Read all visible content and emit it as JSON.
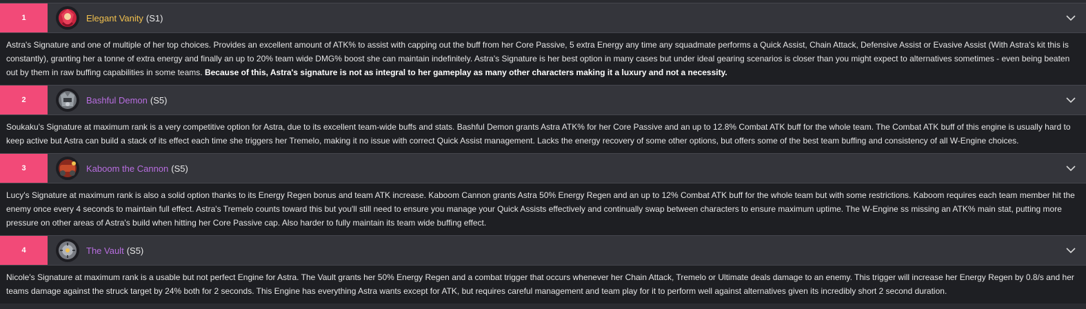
{
  "items": [
    {
      "rank": "1",
      "name": "Elegant Vanity",
      "rank_label": "(S1)",
      "name_color": "gold",
      "icon": "elegant-vanity-engine-icon",
      "description": "Astra's Signature and one of multiple of her top choices. Provides an excellent amount of ATK% to assist with capping out the buff from her Core Passive, 5 extra Energy any time any squadmate performs a Quick Assist, Chain Attack, Defensive Assist or Evasive Assist (With Astra's kit this is constantly), granting her a tonne of extra energy and finally an up to 20% team wide DMG% boost she can maintain indefinitely. Astra's Signature is her best option in many cases but under ideal gearing scenarios is closer than you might expect to alternatives sometimes - even being beaten out by them in raw buffing capabilities in some teams. ",
      "description_bold": "Because of this, Astra's signature is not as integral to her gameplay as many other characters making it a luxury and not a necessity."
    },
    {
      "rank": "2",
      "name": "Bashful Demon",
      "rank_label": "(S5)",
      "name_color": "purple",
      "icon": "bashful-demon-engine-icon",
      "description": "Soukaku's Signature at maximum rank is a very competitive option for Astra, due to its excellent team-wide buffs and stats. Bashful Demon grants Astra ATK% for her Core Passive and an up to 12.8% Combat ATK buff for the whole team. The Combat ATK buff of this engine is usually hard to keep active but Astra can build a stack of its effect each time she triggers her Tremelo, making it no issue with correct Quick Assist management. Lacks the energy recovery of some other options, but offers some of the best team buffing and consistency of all W-Engine choices.",
      "description_bold": ""
    },
    {
      "rank": "3",
      "name": "Kaboom the Cannon",
      "rank_label": "(S5)",
      "name_color": "purple",
      "icon": "kaboom-cannon-engine-icon",
      "description": "Lucy's Signature at maximum rank is also a solid option thanks to its Energy Regen bonus and team ATK increase. Kaboom Cannon grants Astra 50% Energy Regen and an up to 12% Combat ATK buff for the whole team but with some restrictions. Kaboom requires each team member hit the enemy once every 4 seconds to maintain full effect. Astra's Tremelo counts toward this but you'll still need to ensure you manage your Quick Assists effectively and continually swap between characters to ensure maximum uptime. The W-Engine ss missing an ATK% main stat, putting more pressure on other areas of Astra's build when hitting her Core Passive cap. Also harder to fully maintain its team wide buffing effect.",
      "description_bold": ""
    },
    {
      "rank": "4",
      "name": "The Vault",
      "rank_label": "(S5)",
      "name_color": "purple",
      "icon": "the-vault-engine-icon",
      "description": "Nicole's Signature at maximum rank is a usable but not perfect Engine for Astra. The Vault grants her 50% Energy Regen and a combat trigger that occurs whenever her Chain Attack, Tremelo or Ultimate deals damage to an enemy. This trigger will increase her Energy Regen by 0.8/s and her teams damage against the struck target by 24% both for 2 seconds. This Engine has everything Astra wants except for ATK, but requires careful management and team play for it to perform well against alternatives given its incredibly short 2 second duration.",
      "description_bold": ""
    }
  ],
  "colors": {
    "rank_bg": "#f24a78",
    "gold": "#f2c14e",
    "purple": "#b86ee0"
  }
}
